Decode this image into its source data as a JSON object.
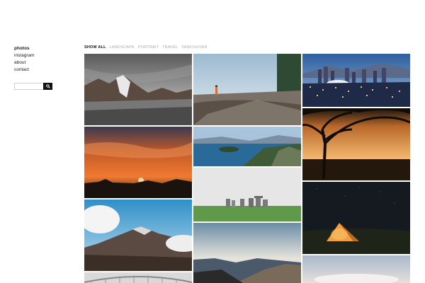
{
  "nav": {
    "items": [
      {
        "label": "photos",
        "active": true
      },
      {
        "label": "instagram",
        "active": false
      },
      {
        "label": "about",
        "active": false
      },
      {
        "label": "contact",
        "active": false
      }
    ]
  },
  "search": {
    "placeholder": "",
    "value": ""
  },
  "filters": [
    {
      "label": "SHOW ALL",
      "active": true
    },
    {
      "label": "LANDSCAPE",
      "active": false
    },
    {
      "label": "PORTRAIT",
      "active": false
    },
    {
      "label": "TRAVEL",
      "active": false
    },
    {
      "label": "VANCOUVER",
      "active": false
    }
  ],
  "colors": {
    "text": "#222222",
    "muted": "#a9a9a9",
    "accent": "#111111"
  }
}
